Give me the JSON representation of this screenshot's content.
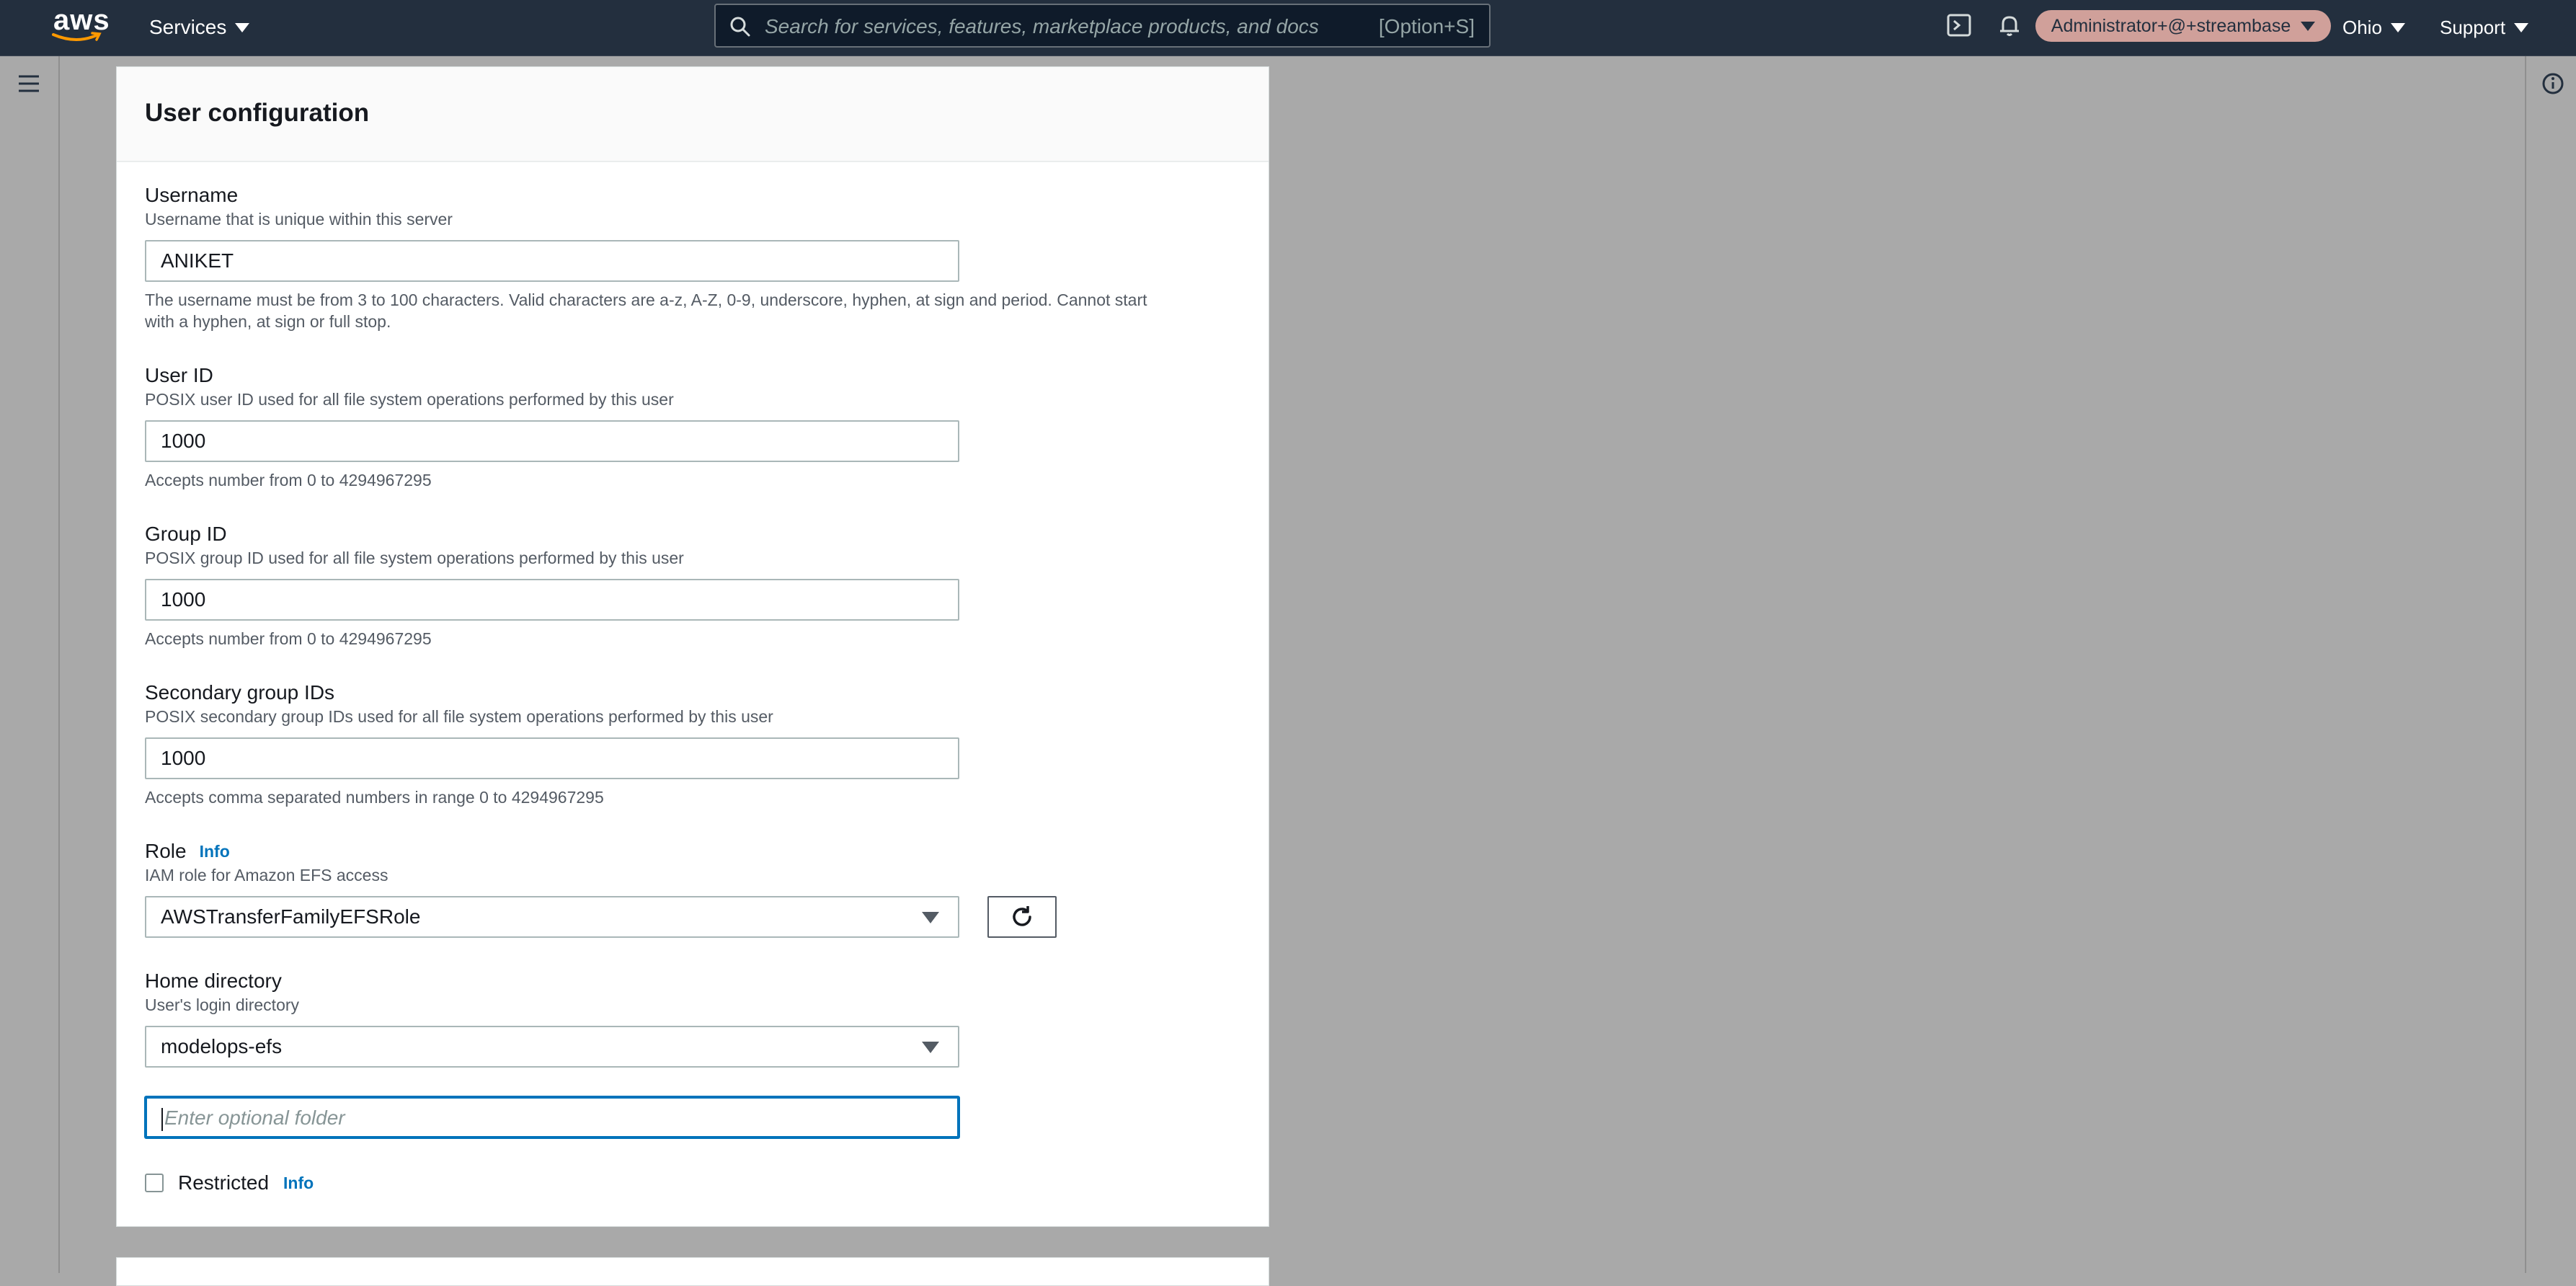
{
  "topnav": {
    "logo_text": "aws",
    "services_label": "Services",
    "search_placeholder": "Search for services, features, marketplace products, and docs",
    "search_shortcut": "[Option+S]",
    "account_label": "Administrator+@+streambase",
    "region_label": "Ohio",
    "support_label": "Support"
  },
  "panel": {
    "title": "User configuration"
  },
  "username": {
    "label": "Username",
    "description": "Username that is unique within this server",
    "value": "ANIKET",
    "constraint_line1": "The username must be from 3 to 100 characters. Valid characters are a-z, A-Z, 0-9, underscore, hyphen, at sign and period. Cannot start",
    "constraint_line2": "with a hyphen, at sign or full stop."
  },
  "user_id": {
    "label": "User ID",
    "description": "POSIX user ID used for all file system operations performed by this user",
    "value": "1000",
    "constraint": "Accepts number from 0 to 4294967295"
  },
  "group_id": {
    "label": "Group ID",
    "description": "POSIX group ID used for all file system operations performed by this user",
    "value": "1000",
    "constraint": "Accepts number from 0 to 4294967295"
  },
  "secondary_group_ids": {
    "label": "Secondary group IDs",
    "description": "POSIX secondary group IDs used for all file system operations performed by this user",
    "value": "1000",
    "constraint": "Accepts comma separated numbers in range 0 to 4294967295"
  },
  "role": {
    "label": "Role",
    "info_label": "Info",
    "description": "IAM role for Amazon EFS access",
    "selected": "AWSTransferFamilyEFSRole"
  },
  "home_directory": {
    "label": "Home directory",
    "description": "User's login directory",
    "selected": "modelops-efs",
    "folder_placeholder": "Enter optional folder"
  },
  "restricted": {
    "label": "Restricted",
    "info_label": "Info",
    "checked": false
  },
  "colors": {
    "nav_bg": "#232f3e",
    "overlay_bg": "#a9a9a9",
    "link": "#0073bb",
    "account_pill": "#d0a09a"
  }
}
